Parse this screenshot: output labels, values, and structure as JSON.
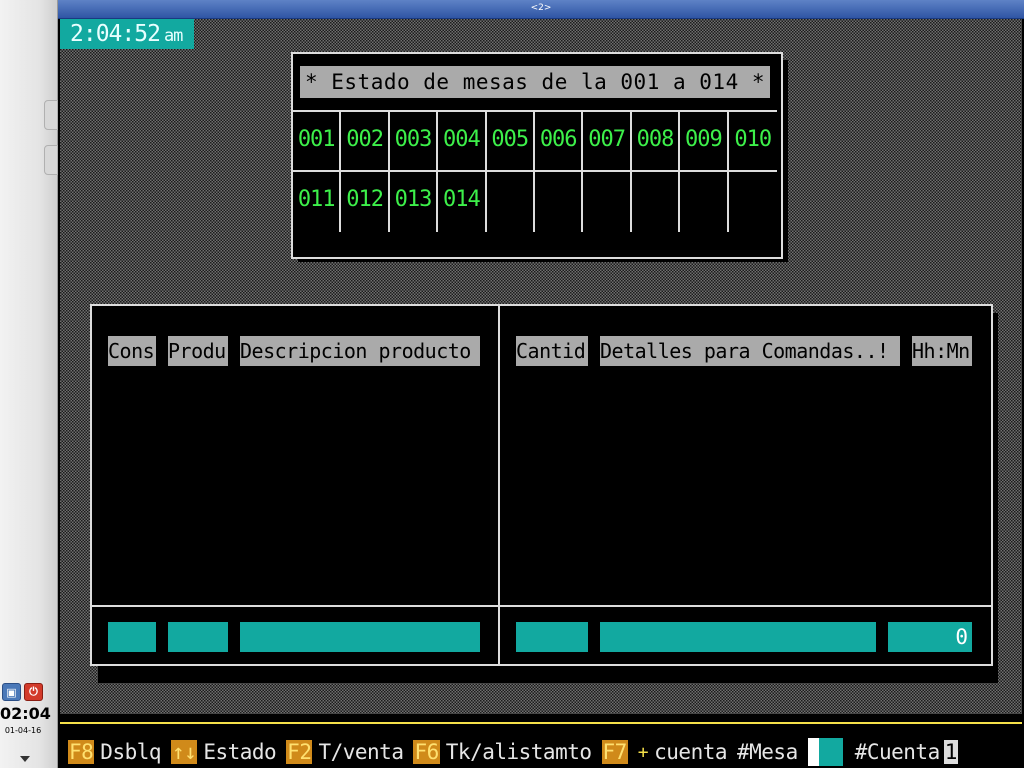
{
  "desktop": {
    "clock_time": "02:04",
    "clock_date": "01-04-16"
  },
  "window": {
    "title": "<2>"
  },
  "terminal": {
    "time": "2:04:52",
    "ampm": "am",
    "mesas": {
      "title": "* Estado de mesas de la 001 a 014 *",
      "tables": [
        "001",
        "002",
        "003",
        "004",
        "005",
        "006",
        "007",
        "008",
        "009",
        "010",
        "011",
        "012",
        "013",
        "014",
        "",
        "",
        "",
        "",
        "",
        ""
      ]
    },
    "productos": {
      "headers": {
        "cons": "Cons",
        "produ": "Produ",
        "descripcion": "Descripcion producto",
        "cantid": "Cantid",
        "detalles": "Detalles para Comandas..!",
        "hhmn": "Hh:Mn"
      },
      "footer": {
        "cons": "",
        "produ": "",
        "descripcion": "",
        "cantid": "",
        "detalles": "",
        "hhmn": "0"
      }
    },
    "statusbar": {
      "f8_key": "F8",
      "f8_label": "Dsblq",
      "arrows_key": "↑↓",
      "arrows_label": "Estado",
      "f2_key": "F2",
      "f2_label": "T/venta",
      "f6_key": "F6",
      "f6_label": "Tk/alistamto",
      "f7_key": "F7",
      "plus": "+",
      "f7_label": "cuenta",
      "mesa_label": "#Mesa",
      "cuenta_label": "#Cuenta",
      "cuenta_value": "1"
    }
  },
  "colors": {
    "cyan": "#12a9a0",
    "green_text": "#3df04a",
    "gray_header": "#aaaaaa",
    "orange_key": "#d08a1a",
    "yellow_rule": "#f5e04a"
  }
}
